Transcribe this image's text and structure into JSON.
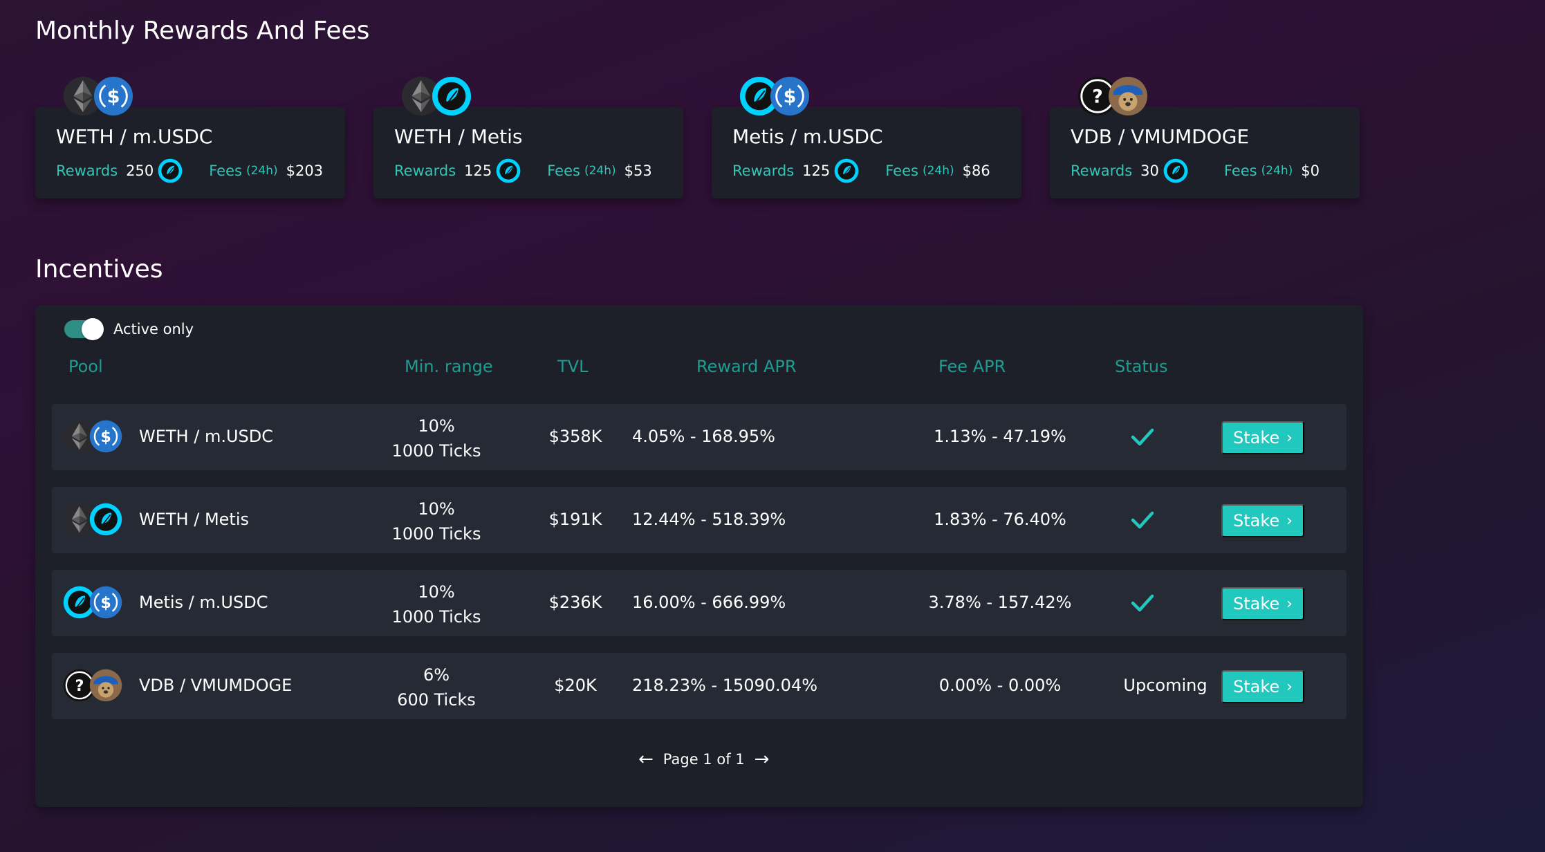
{
  "rewards_section": {
    "title": "Monthly Rewards And Fees",
    "cards": [
      {
        "name": "WETH / m.USDC",
        "rewards_label": "Rewards",
        "rewards_value": "250",
        "fees_label": "Fees",
        "fees_period": "(24h)",
        "fees_value": "$203",
        "icon_a": "weth-icon",
        "icon_b": "usdc-icon"
      },
      {
        "name": "WETH / Metis",
        "rewards_label": "Rewards",
        "rewards_value": "125",
        "fees_label": "Fees",
        "fees_period": "(24h)",
        "fees_value": "$53",
        "icon_a": "weth-icon",
        "icon_b": "metis-icon"
      },
      {
        "name": "Metis / m.USDC",
        "rewards_label": "Rewards",
        "rewards_value": "125",
        "fees_label": "Fees",
        "fees_period": "(24h)",
        "fees_value": "$86",
        "icon_a": "metis-icon",
        "icon_b": "usdc-icon"
      },
      {
        "name": "VDB / VMUMDOGE",
        "rewards_label": "Rewards",
        "rewards_value": "30",
        "fees_label": "Fees",
        "fees_period": "(24h)",
        "fees_value": "$0",
        "icon_a": "unknown-token-icon",
        "icon_b": "doge-icon"
      }
    ]
  },
  "incentives": {
    "title": "Incentives",
    "toggle_label": "Active only",
    "toggle_on": true,
    "columns": {
      "pool": "Pool",
      "min_range": "Min. range",
      "tvl": "TVL",
      "reward_apr": "Reward APR",
      "fee_apr": "Fee APR",
      "status": "Status"
    },
    "rows": [
      {
        "pool": "WETH / m.USDC",
        "min_pct": "10%",
        "min_ticks": "1000 Ticks",
        "tvl": "$358K",
        "reward_apr": "4.05% - 168.95%",
        "fee_apr": "1.13% - 47.19%",
        "status": "",
        "stake_label": "Stake"
      },
      {
        "pool": "WETH / Metis",
        "min_pct": "10%",
        "min_ticks": "1000 Ticks",
        "tvl": "$191K",
        "reward_apr": "12.44% - 518.39%",
        "fee_apr": "1.83% - 76.40%",
        "status": "",
        "stake_label": "Stake"
      },
      {
        "pool": "Metis / m.USDC",
        "min_pct": "10%",
        "min_ticks": "1000 Ticks",
        "tvl": "$236K",
        "reward_apr": "16.00% - 666.99%",
        "fee_apr": "3.78% - 157.42%",
        "status": "",
        "stake_label": "Stake"
      },
      {
        "pool": "VDB / VMUMDOGE",
        "min_pct": "6%",
        "min_ticks": "600 Ticks",
        "tvl": "$20K",
        "reward_apr": "218.23% - 15090.04%",
        "fee_apr": "0.00% - 0.00%",
        "status": "Upcoming",
        "stake_label": "Stake"
      }
    ],
    "pagination": {
      "text": "Page 1 of 1"
    }
  },
  "colors": {
    "accent": "#20c8bd",
    "header_teal": "#1f9d91",
    "card_bg": "#1d1f29",
    "row_bg": "#262a35"
  }
}
